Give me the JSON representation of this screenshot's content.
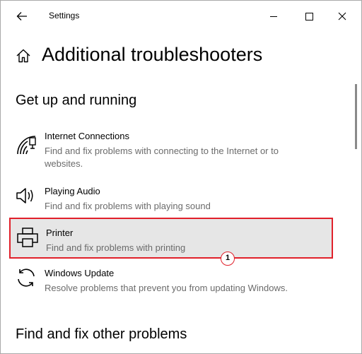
{
  "window": {
    "title": "Settings"
  },
  "header": {
    "title": "Additional troubleshooters"
  },
  "sections": {
    "get_up": {
      "title": "Get up and running"
    },
    "other": {
      "title": "Find and fix other problems"
    }
  },
  "items": [
    {
      "title": "Internet Connections",
      "desc": "Find and fix problems with connecting to the Internet or to websites.",
      "icon": "wifi-network-icon"
    },
    {
      "title": "Playing Audio",
      "desc": "Find and fix problems with playing sound",
      "icon": "speaker-icon"
    },
    {
      "title": "Printer",
      "desc": "Find and fix problems with printing",
      "icon": "printer-icon"
    },
    {
      "title": "Windows Update",
      "desc": "Resolve problems that prevent you from updating Windows.",
      "icon": "sync-icon"
    }
  ],
  "annotation": {
    "step": "1"
  },
  "colors": {
    "highlight_border": "#e0202a",
    "selected_bg": "#e6e6e6"
  }
}
